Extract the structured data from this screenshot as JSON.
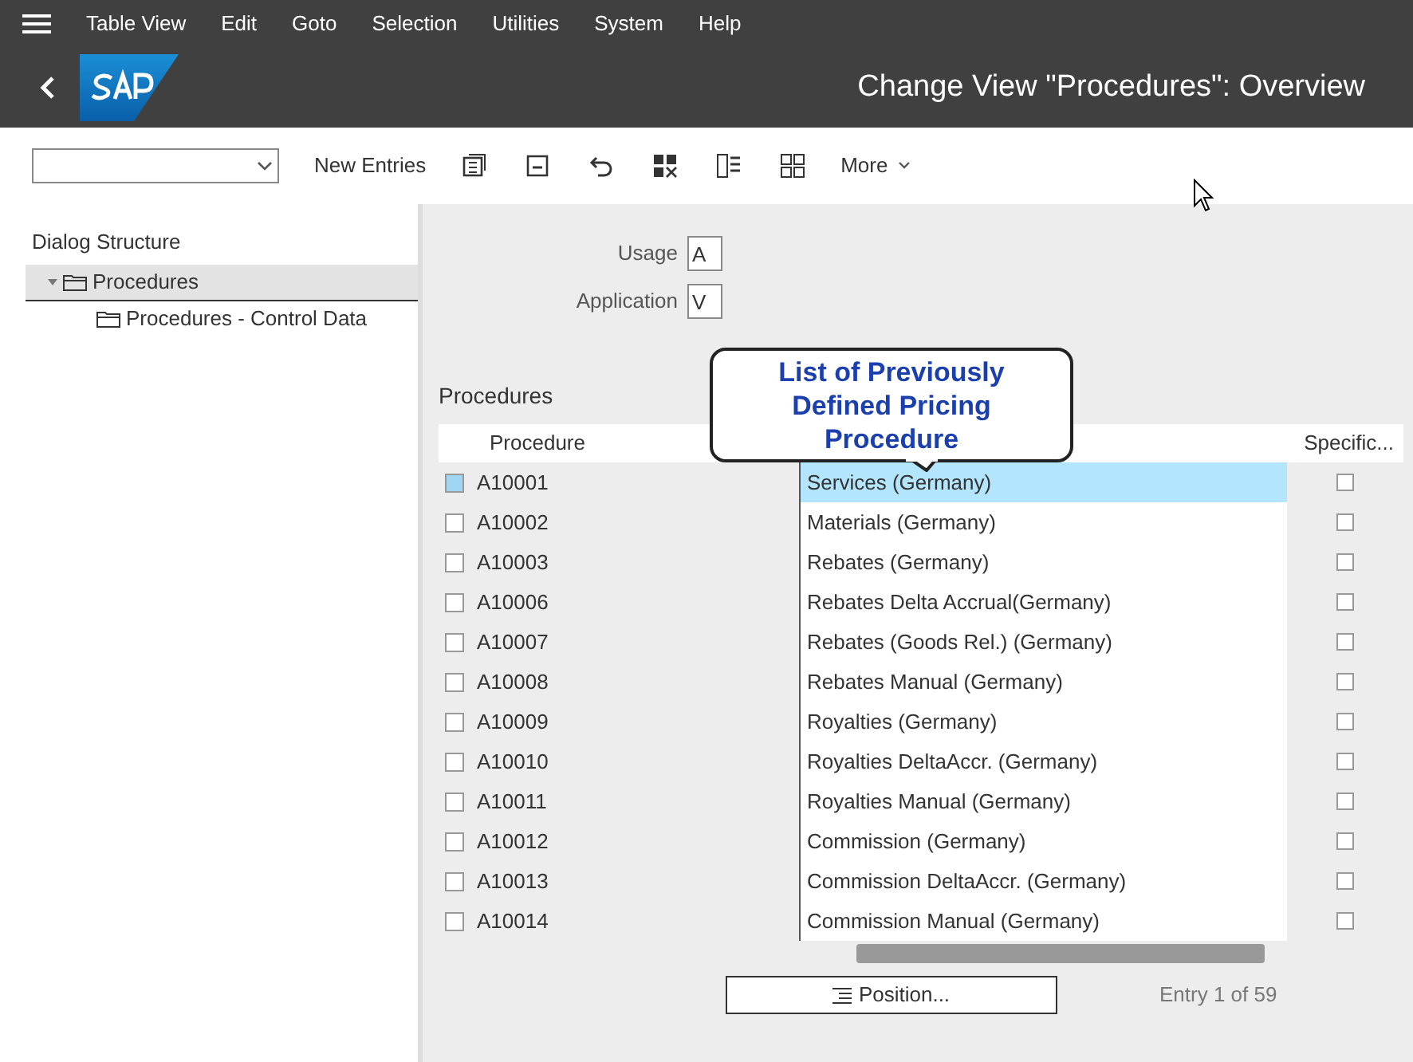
{
  "menu_bar": [
    "Table View",
    "Edit",
    "Goto",
    "Selection",
    "Utilities",
    "System",
    "Help"
  ],
  "header": {
    "title": "Change View \"Procedures\": Overview"
  },
  "toolbar": {
    "buttons": [
      "New Entries"
    ],
    "more": "More"
  },
  "dialog_structure": {
    "title": "Dialog Structure",
    "items": [
      {
        "label": "Procedures",
        "selected": true,
        "expanded": true,
        "children": [
          {
            "label": "Procedures - Control Data",
            "selected": false
          }
        ]
      }
    ]
  },
  "fields": [
    {
      "label": "Usage",
      "value": "A"
    },
    {
      "label": "Application",
      "value": "V"
    }
  ],
  "table": {
    "title": "Procedures",
    "columns": [
      "Procedure",
      "Specific..."
    ],
    "rows": [
      {
        "procedure": "A10001",
        "description": "Services (Germany)",
        "selected": true,
        "checked": false
      },
      {
        "procedure": "A10002",
        "description": "Materials (Germany)",
        "selected": false,
        "checked": false
      },
      {
        "procedure": "A10003",
        "description": "Rebates (Germany)",
        "selected": false,
        "checked": false
      },
      {
        "procedure": "A10006",
        "description": "Rebates Delta Accrual(Germany)",
        "selected": false,
        "checked": false
      },
      {
        "procedure": "A10007",
        "description": "Rebates (Goods Rel.) (Germany)",
        "selected": false,
        "checked": false
      },
      {
        "procedure": "A10008",
        "description": "Rebates Manual (Germany)",
        "selected": false,
        "checked": false
      },
      {
        "procedure": "A10009",
        "description": "Royalties (Germany)",
        "selected": false,
        "checked": false
      },
      {
        "procedure": "A10010",
        "description": "Royalties DeltaAccr. (Germany)",
        "selected": false,
        "checked": false
      },
      {
        "procedure": "A10011",
        "description": "Royalties Manual (Germany)",
        "selected": false,
        "checked": false
      },
      {
        "procedure": "A10012",
        "description": "Commission (Germany)",
        "selected": false,
        "checked": false
      },
      {
        "procedure": "A10013",
        "description": "Commission DeltaAccr. (Germany)",
        "selected": false,
        "checked": false
      },
      {
        "procedure": "A10014",
        "description": "Commission Manual (Germany)",
        "selected": false,
        "checked": false
      }
    ]
  },
  "position_button": "Position...",
  "entry_count": "Entry 1 of 59",
  "callout": "List of Previously Defined Pricing Procedure"
}
